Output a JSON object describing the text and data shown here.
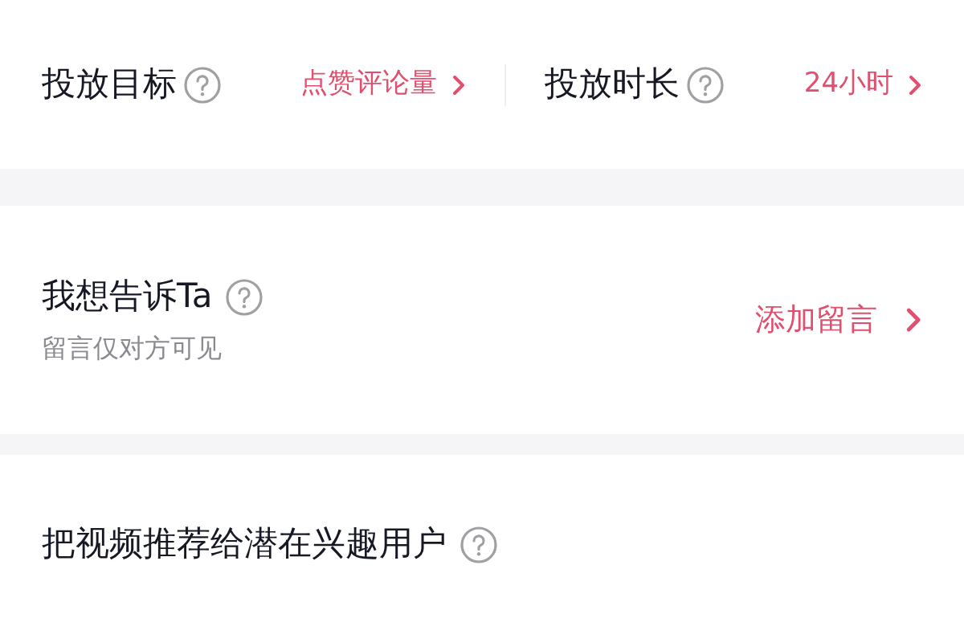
{
  "top_row": [
    {
      "label": "投放目标",
      "help": true,
      "value": "点赞评论量"
    },
    {
      "label": "投放时长",
      "help": true,
      "value": "24小时"
    }
  ],
  "message": {
    "title": "我想告诉Ta",
    "help": true,
    "subtitle": "留言仅对方可见",
    "action": "添加留言"
  },
  "recommend": {
    "title": "把视频推荐给潜在兴趣用户",
    "help": true
  }
}
